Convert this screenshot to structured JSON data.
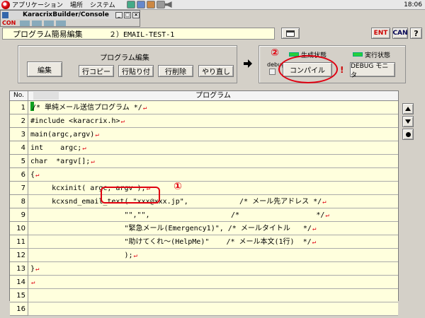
{
  "os": {
    "menu": [
      "アプリケーション",
      "場所",
      "システム"
    ],
    "time": "18:06"
  },
  "console": {
    "title": "KaracrixBuilder/Console",
    "minimize": "_",
    "maximize": "□",
    "close": "×",
    "con_label": "CON"
  },
  "header": {
    "title": "プログラム簡易編集",
    "program": "２）EMAIL-TEST-1",
    "ent": "ENT",
    "can": "CAN",
    "help": "?"
  },
  "edit": {
    "label": "プログラム編集",
    "edit": "編集",
    "copy": "行コピー",
    "paste": "行貼り付",
    "delete": "行削除",
    "redo": "やり直し"
  },
  "compile": {
    "annotation": "②",
    "gen_state": "生成状態",
    "run_state": "実行状態",
    "debug": "debug",
    "compile": "コンパイル",
    "warn": "!",
    "debug_monitor": "DEBUG モニタ",
    "led_color": "#27d03a"
  },
  "table": {
    "no_header": "No.",
    "prog_header": "プログラム",
    "return_mark": "↵",
    "rows": [
      {
        "no": "1",
        "code": "/* 単純メール送信プログラム */",
        "cursor": true
      },
      {
        "no": "2",
        "code": "#include <karacrix.h>"
      },
      {
        "no": "3",
        "code": "main(argc,argv)"
      },
      {
        "no": "4",
        "code": "int    argc;"
      },
      {
        "no": "5",
        "code": "char  *argv[];"
      },
      {
        "no": "6",
        "code": "{"
      },
      {
        "no": "7",
        "code": "     kcxinit( argc, argv );"
      },
      {
        "no": "8",
        "code": "     kcxsnd_email_text( \"xxx@xxx.jp\",            /* メール先アドレス */"
      },
      {
        "no": "9",
        "code": "                      \"\",\"\",                   /*                  */"
      },
      {
        "no": "10",
        "code": "                      \"緊急メール(Emergency1)\", /* メールタイトル   */"
      },
      {
        "no": "11",
        "code": "                      \"助けてくれ〜(HelpMe)\"    /* メール本文(1行)  */"
      },
      {
        "no": "12",
        "code": "                      );"
      },
      {
        "no": "13",
        "code": "}"
      },
      {
        "no": "14",
        "code": ""
      },
      {
        "no": "15",
        "code": "",
        "noret": true
      },
      {
        "no": "16",
        "code": "",
        "noret": true
      }
    ]
  },
  "annotation1": "①",
  "colors": {
    "annotation": "#e00010",
    "row_bg": "#ffffdd"
  }
}
